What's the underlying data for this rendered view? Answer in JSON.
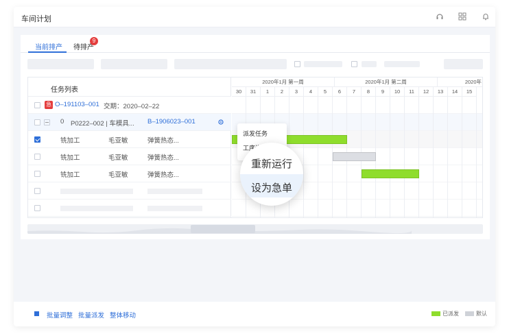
{
  "app": {
    "title": "车间计划"
  },
  "tabs": [
    {
      "label": "当前排产",
      "active": true
    },
    {
      "label": "待排产",
      "badge": "9"
    }
  ],
  "list_header": "任务列表",
  "order": {
    "urgent_tag": "急",
    "code": "O–191103–001",
    "due": "交期：2020–02–22"
  },
  "part": {
    "qty": "0",
    "code": "P0222–002 | 车模具...",
    "batch": "B–1906023–001"
  },
  "tasks": [
    {
      "process": "铣加工",
      "person": "毛亚敏",
      "step": "弹簧热态...",
      "checked": true
    },
    {
      "process": "铣加工",
      "person": "毛亚敏",
      "step": "弹簧热态...",
      "checked": false
    },
    {
      "process": "铣加工",
      "person": "毛亚敏",
      "step": "弹簧热态...",
      "checked": false
    }
  ],
  "gantt": {
    "weeks": [
      "2020年1月 第一周",
      "2020年1月 第二周",
      "2020年"
    ],
    "days": [
      "30",
      "31",
      "1",
      "2",
      "3",
      "4",
      "5",
      "6",
      "7",
      "8",
      "9",
      "10",
      "11",
      "12",
      "13",
      "14",
      "15"
    ],
    "bars": [
      {
        "row": 1,
        "start_day_index": 0,
        "end_day_index": 8,
        "status": "dispatched"
      },
      {
        "row": 2,
        "start_day_index": 7,
        "end_day_index": 10,
        "status": "default"
      },
      {
        "row": 3,
        "start_day_index": 9,
        "end_day_index": 13,
        "status": "dispatched"
      }
    ]
  },
  "context_menu": [
    "派发任务",
    "工序详情",
    "重新运行",
    "设为急单"
  ],
  "footer": {
    "links": [
      "批量调整",
      "批量派发",
      "整体移动"
    ]
  },
  "legend": [
    {
      "label": "已派发",
      "color": "#8fdd2c"
    },
    {
      "label": "默认",
      "color": "#cfd2d8"
    }
  ],
  "colors": {
    "accent": "#2f6fd8",
    "dispatched": "#8fdd2c",
    "default_bar": "#dcdee3",
    "urgent": "#e43d3d"
  }
}
